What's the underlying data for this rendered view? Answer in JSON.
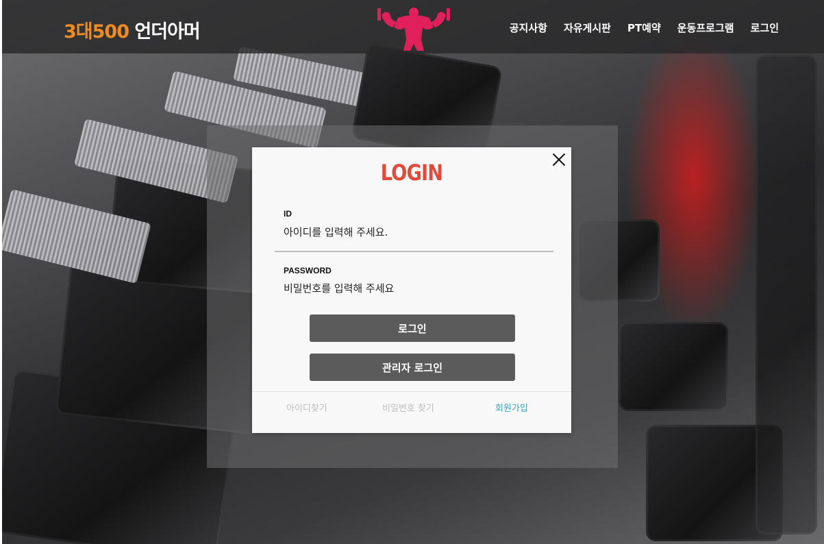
{
  "header": {
    "brand_accent": "3대500",
    "brand_name": "언더아머",
    "logo_icon": "muscle-man-logo-icon",
    "nav": [
      {
        "label": "공지사항"
      },
      {
        "label": "자유게시판"
      },
      {
        "label": "PT예약"
      },
      {
        "label": "운동프로그램"
      },
      {
        "label": "로그인"
      }
    ]
  },
  "modal": {
    "title": "LOGIN",
    "close_icon": "close-icon",
    "id_label": "ID",
    "id_placeholder": "아이디를 입력해 주세요.",
    "password_label": "PASSWORD",
    "password_placeholder": "비밀번호를 입력해 주세요",
    "login_button": "로그인",
    "admin_login_button": "관리자 로그인",
    "footer": {
      "find_id": "아이디찾기",
      "find_password": "비밀번호 찾기",
      "signup": "회원가입"
    }
  },
  "colors": {
    "brand_accent": "#f08a24",
    "title": "#e04a3a",
    "button": "#5b5b5b",
    "signup_link": "#3aa6b7",
    "logo": "#e0205a"
  }
}
